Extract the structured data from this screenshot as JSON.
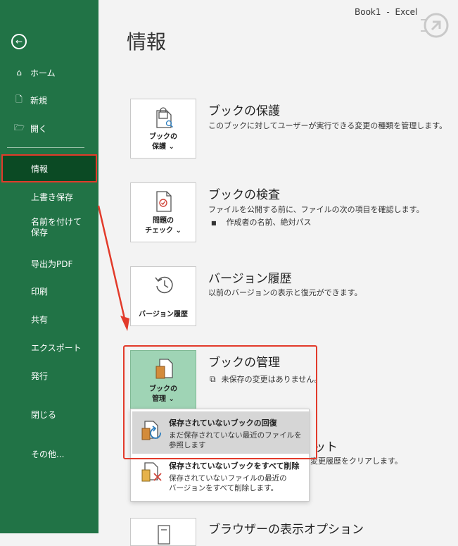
{
  "titlebar": {
    "document": "Book1",
    "separator": "-",
    "app": "Excel"
  },
  "sidebar": {
    "items": [
      {
        "label": "ホーム",
        "icon": "home-icon"
      },
      {
        "label": "新規",
        "icon": "new-document-icon"
      },
      {
        "label": "開く",
        "icon": "open-folder-icon"
      },
      {
        "label": "情報"
      },
      {
        "label": "上書き保存"
      },
      {
        "label": "名前を付けて保存"
      },
      {
        "label": "导出为PDF"
      },
      {
        "label": "印刷"
      },
      {
        "label": "共有"
      },
      {
        "label": "エクスポート"
      },
      {
        "label": "発行"
      },
      {
        "label": "閉じる"
      },
      {
        "label": "その他..."
      }
    ]
  },
  "page": {
    "title": "情報"
  },
  "sections": [
    {
      "tile_line1": "ブックの",
      "tile_line2": "保護 ⌄",
      "title": "ブックの保護",
      "desc": "このブックに対してユーザーが実行できる変更の種類を管理します。"
    },
    {
      "tile_line1": "問題の",
      "tile_line2": "チェック ⌄",
      "title": "ブックの検査",
      "desc": "ファイルを公開する前に、ファイルの次の項目を確認します。",
      "bullet": "作成者の名前、絶対パス"
    },
    {
      "tile_line1": "バージョン履歴",
      "title": "バージョン履歴",
      "desc": "以前のバージョンの表示と復元ができます。"
    },
    {
      "tile_line1": "ブックの",
      "tile_line2": "管理 ⌄",
      "title": "ブックの管理",
      "desc": "未保存の変更はありません。"
    },
    {
      "title_fragment": "ット",
      "desc_fragment": "変更履歴をクリアします。"
    },
    {
      "title": "ブラウザーの表示オプション"
    }
  ],
  "manage_menu": [
    {
      "title": "保存されていないブックの回復",
      "desc_line1": "まだ保存されていない最近のファイルを",
      "desc_line2": "参照します"
    },
    {
      "title": "保存されていないブックをすべて削除",
      "desc_line1": "保存されていないファイルの最近の",
      "desc_line2": "バージョンをすべて削除します。"
    }
  ],
  "colors": {
    "sidebar": "#217346",
    "active": "#0b4a24",
    "annotation": "#e23a2a",
    "tile_selected": "#9fd4b5"
  }
}
